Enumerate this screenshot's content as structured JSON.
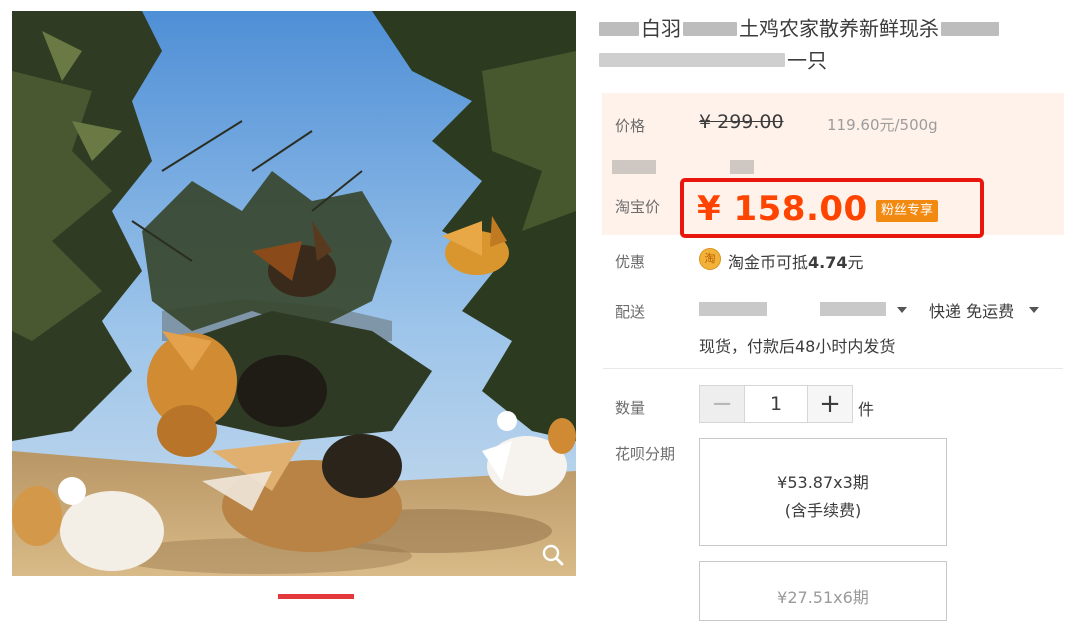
{
  "product": {
    "title_line1": "白羽",
    "title_line1b": "土鸡农家散养新鲜现杀",
    "title_line2": "一只"
  },
  "price": {
    "label": "价格",
    "original": "¥ 299.00",
    "unit_price": "119.60元/500g",
    "taobao_label": "淘宝价",
    "current": "¥ 158.00",
    "badge": "粉丝专享"
  },
  "promo": {
    "label": "优惠",
    "coin_icon": "淘",
    "text_prefix": "淘金币可抵",
    "amount": "4.74",
    "text_suffix": "元"
  },
  "delivery": {
    "label": "配送",
    "method": "快递 免运费",
    "note": "现货，付款后48小时内发货"
  },
  "quantity": {
    "label": "数量",
    "value": "1",
    "minus": "−",
    "plus": "+",
    "unit": "件"
  },
  "installments": {
    "label": "花呗分期",
    "plans": [
      {
        "line1": "¥53.87x3期",
        "line2": "(含手续费)"
      },
      {
        "line1": "¥27.51x6期"
      }
    ]
  },
  "colors": {
    "accent": "#ff4400",
    "highlight_border": "#e8160c",
    "badge_bg": "#f28a12",
    "price_box_bg": "#fff2ea"
  },
  "icons": [
    "zoom-icon",
    "coin-icon",
    "chevron-down-icon"
  ]
}
